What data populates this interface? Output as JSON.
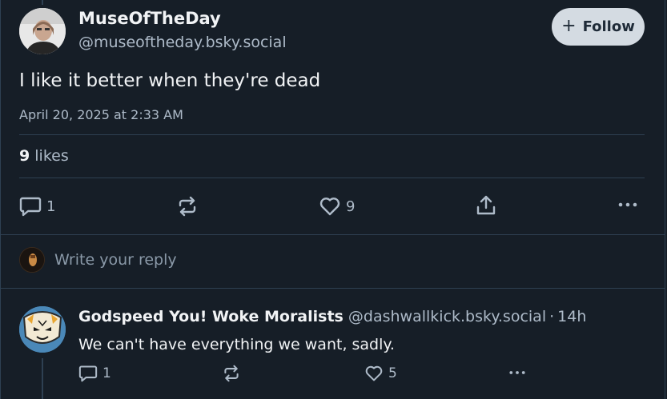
{
  "post": {
    "display_name": "MuseOfTheDay",
    "handle": "@museoftheday.bsky.social",
    "follow_label": "Follow",
    "text": "I like it better when they're dead",
    "timestamp": "April 20, 2025 at 2:33 AM",
    "likes_count": "9",
    "likes_label": "likes",
    "reply_count": "1",
    "like_count": "9"
  },
  "composer": {
    "placeholder": "Write your reply"
  },
  "reply": {
    "display_name": "Godspeed You! Woke Moralists",
    "handle": "@dashwallkick.bsky.social",
    "separator": "·",
    "time": "14h",
    "text": "We can't have everything we want, sadly.",
    "reply_count": "1",
    "like_count": "5"
  },
  "colors": {
    "background": "#161e27",
    "divider": "#2e4052",
    "muted_text": "#aebbc9",
    "follow_bg": "#d4dbe2"
  },
  "icons": [
    "reply-icon",
    "repost-icon",
    "heart-icon",
    "share-icon",
    "more-icon",
    "plus-icon"
  ]
}
